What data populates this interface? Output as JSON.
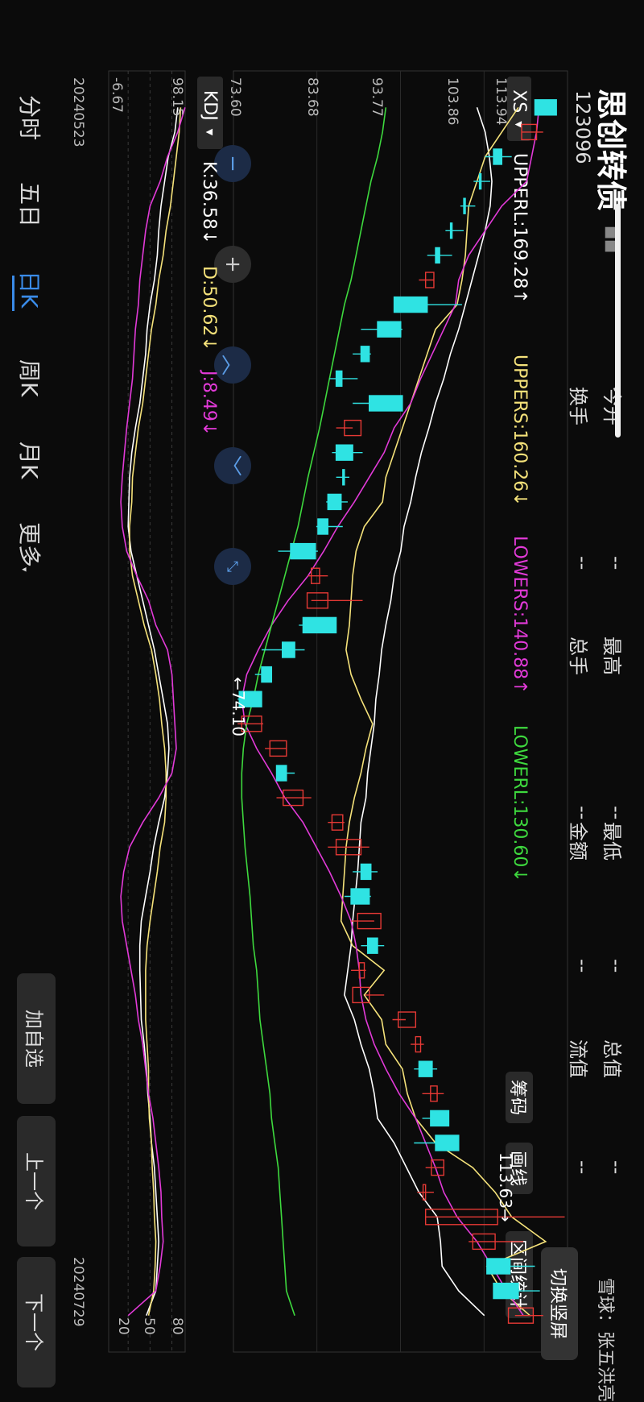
{
  "header": {
    "title": "思创转债",
    "code": "123096",
    "title_badge": "■■",
    "orientation_button": "切换竖屏"
  },
  "quote": [
    {
      "label": "今开",
      "value": "--"
    },
    {
      "label": "最高",
      "value": "--"
    },
    {
      "label": "最低",
      "value": "--"
    },
    {
      "label": "总值",
      "value": "--"
    },
    {
      "label": "换手",
      "value": "--"
    },
    {
      "label": "总手",
      "value": "--"
    },
    {
      "label": "金额",
      "value": "--"
    },
    {
      "label": "流值",
      "value": "--"
    }
  ],
  "main_indicator": {
    "selector": "XS",
    "items": [
      {
        "label": "UPPERL:169.28↑",
        "color": "#ffffff"
      },
      {
        "label": "UPPERS:160.26↓",
        "color": "#f5e27a"
      },
      {
        "label": "LOWERS:140.88↑",
        "color": "#e23ad8"
      },
      {
        "label": "LOWERL:130.60↓",
        "color": "#3ed93e"
      }
    ]
  },
  "tools": {
    "chips": "筹码",
    "draw": "画线",
    "range": "区间统计"
  },
  "sub_indicator": {
    "selector": "KDJ",
    "items": [
      {
        "label": "K:36.58↓",
        "color": "#ffffff"
      },
      {
        "label": "D:50.62↓",
        "color": "#f5e27a"
      },
      {
        "label": "J:8.49↓",
        "color": "#e23ad8"
      }
    ]
  },
  "price_axis": [
    "113.94",
    "103.86",
    "93.77",
    "83.68",
    "73.60"
  ],
  "kdj_axis": [
    "98.15",
    "80",
    "50",
    "20",
    "-6.67"
  ],
  "annotations": {
    "high": "113.63→",
    "low": "←74.10"
  },
  "dates": {
    "start": "20240523",
    "end": "20240729"
  },
  "tabs": [
    {
      "label": "分时",
      "active": false
    },
    {
      "label": "五日",
      "active": false
    },
    {
      "label": "日K",
      "active": true
    },
    {
      "label": "周K",
      "active": false
    },
    {
      "label": "月K",
      "active": false
    },
    {
      "label": "更多",
      "active": false
    }
  ],
  "side_buttons": [
    "加自选",
    "上一个",
    "下一个"
  ],
  "watermark": "雪球：张五洪亮",
  "colors": {
    "up": "#e53935",
    "down": "#2fe3e3",
    "accent": "#3a8be8"
  },
  "chart_data": {
    "type": "candlestick",
    "ylim": [
      73.6,
      113.94
    ],
    "candles": [
      {
        "o": 110.0,
        "h": 112.6,
        "l": 110.0,
        "c": 112.6,
        "up": false
      },
      {
        "o": 110.2,
        "h": 111.0,
        "l": 108.4,
        "c": 108.4,
        "up": true
      },
      {
        "o": 105.0,
        "h": 107.2,
        "l": 104.0,
        "c": 106.0,
        "up": false
      },
      {
        "o": 103.5,
        "h": 104.6,
        "l": 102.6,
        "c": 103.5,
        "up": false
      },
      {
        "o": 101.6,
        "h": 102.8,
        "l": 101.0,
        "c": 101.6,
        "up": false
      },
      {
        "o": 100.0,
        "h": 101.4,
        "l": 99.2,
        "c": 100.0,
        "up": false
      },
      {
        "o": 98.5,
        "h": 100.0,
        "l": 97.0,
        "c": 98.0,
        "up": false
      },
      {
        "o": 96.8,
        "h": 97.8,
        "l": 96.0,
        "c": 97.8,
        "up": true
      },
      {
        "o": 97.0,
        "h": 101.2,
        "l": 94.8,
        "c": 93.0,
        "up": false
      },
      {
        "o": 91.0,
        "h": 94.0,
        "l": 89.0,
        "c": 93.8,
        "up": false
      },
      {
        "o": 89.0,
        "h": 90.2,
        "l": 88.0,
        "c": 90.0,
        "up": false
      },
      {
        "o": 86.7,
        "h": 88.6,
        "l": 85.2,
        "c": 86.0,
        "up": false
      },
      {
        "o": 90.0,
        "h": 94.0,
        "l": 88.0,
        "c": 94.0,
        "up": false
      },
      {
        "o": 87.0,
        "h": 88.0,
        "l": 86.0,
        "c": 89.0,
        "up": true
      },
      {
        "o": 88.0,
        "h": 89.2,
        "l": 85.5,
        "c": 86.0,
        "up": false
      },
      {
        "o": 87.0,
        "h": 87.6,
        "l": 86.0,
        "c": 86.8,
        "up": false
      },
      {
        "o": 86.6,
        "h": 87.4,
        "l": 84.8,
        "c": 85.0,
        "up": false
      },
      {
        "o": 85.0,
        "h": 86.8,
        "l": 83.6,
        "c": 83.8,
        "up": false
      },
      {
        "o": 80.5,
        "h": 83.8,
        "l": 79.0,
        "c": 83.5,
        "up": false
      },
      {
        "o": 84.0,
        "h": 85.0,
        "l": 82.6,
        "c": 83.0,
        "up": true
      },
      {
        "o": 85.0,
        "h": 89.2,
        "l": 83.0,
        "c": 82.5,
        "up": true
      },
      {
        "o": 82.0,
        "h": 86.0,
        "l": 81.5,
        "c": 86.0,
        "up": false
      },
      {
        "o": 79.5,
        "h": 82.2,
        "l": 77.0,
        "c": 81.0,
        "up": false
      },
      {
        "o": 77.0,
        "h": 78.2,
        "l": 76.2,
        "c": 78.2,
        "up": false
      },
      {
        "o": 74.3,
        "h": 77.0,
        "l": 74.1,
        "c": 77.0,
        "up": false
      },
      {
        "o": 74.6,
        "h": 77.2,
        "l": 74.1,
        "c": 77.0,
        "up": true
      },
      {
        "o": 78.0,
        "h": 80.0,
        "l": 77.4,
        "c": 80.0,
        "up": true
      },
      {
        "o": 80.0,
        "h": 81.0,
        "l": 79.0,
        "c": 78.8,
        "up": false
      },
      {
        "o": 79.6,
        "h": 83.0,
        "l": 78.8,
        "c": 82.0,
        "up": true
      },
      {
        "o": 85.5,
        "h": 87.0,
        "l": 85.0,
        "c": 86.8,
        "up": true
      },
      {
        "o": 86.0,
        "h": 90.0,
        "l": 85.0,
        "c": 89.0,
        "up": true
      },
      {
        "o": 89.0,
        "h": 91.0,
        "l": 88.0,
        "c": 90.2,
        "up": false
      },
      {
        "o": 87.8,
        "h": 90.2,
        "l": 87.0,
        "c": 90.0,
        "up": false
      },
      {
        "o": 88.6,
        "h": 90.6,
        "l": 87.8,
        "c": 91.4,
        "up": true
      },
      {
        "o": 89.8,
        "h": 91.8,
        "l": 89.0,
        "c": 91.0,
        "up": false
      },
      {
        "o": 88.8,
        "h": 89.6,
        "l": 87.8,
        "c": 89.4,
        "up": true
      },
      {
        "o": 90.0,
        "h": 91.8,
        "l": 89.5,
        "c": 88.0,
        "up": true
      },
      {
        "o": 93.5,
        "h": 94.4,
        "l": 92.8,
        "c": 95.6,
        "up": true
      },
      {
        "o": 95.6,
        "h": 96.6,
        "l": 95.0,
        "c": 96.2,
        "up": true
      },
      {
        "o": 96.0,
        "h": 98.2,
        "l": 95.4,
        "c": 97.6,
        "up": false
      },
      {
        "o": 97.4,
        "h": 99.0,
        "l": 96.4,
        "c": 98.2,
        "up": true
      },
      {
        "o": 97.4,
        "h": 99.0,
        "l": 96.4,
        "c": 99.6,
        "up": false
      },
      {
        "o": 98.0,
        "h": 99.0,
        "l": 95.4,
        "c": 100.8,
        "up": false
      },
      {
        "o": 97.5,
        "h": 99.0,
        "l": 96.8,
        "c": 99.0,
        "up": true
      },
      {
        "o": 96.5,
        "h": 97.8,
        "l": 95.8,
        "c": 96.8,
        "up": true
      },
      {
        "o": 96.8,
        "h": 113.6,
        "l": 96.8,
        "c": 105.5,
        "up": true
      },
      {
        "o": 102.5,
        "h": 108.6,
        "l": 102.0,
        "c": 105.2,
        "up": true
      },
      {
        "o": 107.0,
        "h": 110.0,
        "l": 104.5,
        "c": 104.2,
        "up": false
      },
      {
        "o": 108.0,
        "h": 110.6,
        "l": 106.6,
        "c": 105.0,
        "up": false
      },
      {
        "o": 109.8,
        "h": 111.0,
        "l": 107.6,
        "c": 106.8,
        "up": true
      }
    ],
    "lines": {
      "UPPERL": [
        103.0,
        104.0,
        104.5,
        104.8,
        104.6,
        104.0,
        103.2,
        102.4,
        101.6,
        100.8,
        99.8,
        99.0,
        98.0,
        97.2,
        96.3,
        95.6,
        95.0,
        94.2,
        93.8,
        93.0,
        92.6,
        92.0,
        91.5,
        91.2,
        90.8,
        90.6,
        90.2,
        89.8,
        89.6,
        89.0,
        88.8,
        88.6,
        88.3,
        88.0,
        87.8,
        87.4,
        87.0,
        88.2,
        89.0,
        90.0,
        90.6,
        91.0,
        93.0,
        94.5,
        96.0,
        98.2,
        98.6,
        98.8,
        100.8,
        103.9
      ],
      "UPPERS": [
        108.0,
        106.0,
        104.0,
        103.0,
        102.0,
        101.8,
        101.6,
        101.2,
        100.6,
        98.0,
        97.0,
        96.0,
        95.0,
        94.0,
        93.0,
        92.0,
        91.6,
        89.4,
        88.4,
        88.0,
        87.8,
        87.6,
        87.2,
        87.8,
        89.0,
        90.4,
        89.6,
        89.0,
        88.2,
        87.6,
        87.2,
        87.0,
        86.8,
        86.6,
        88.0,
        91.8,
        89.4,
        91.5,
        92.0,
        94.0,
        94.6,
        95.6,
        98.0,
        102.5,
        105.2,
        107.2,
        111.3,
        104.2,
        106.0,
        109.4
      ],
      "LOWERS": [
        110.5,
        110.2,
        109.6,
        109.0,
        106.0,
        104.0,
        102.0,
        100.8,
        100.4,
        99.0,
        97.6,
        96.2,
        95.0,
        93.0,
        91.8,
        90.0,
        88.2,
        86.2,
        84.5,
        82.6,
        80.2,
        78.2,
        76.6,
        75.2,
        74.6,
        75.0,
        76.4,
        78.2,
        79.8,
        82.0,
        83.6,
        85.2,
        86.6,
        87.8,
        88.4,
        88.8,
        89.0,
        89.6,
        90.6,
        92.0,
        93.6,
        95.6,
        96.8,
        98.0,
        99.0,
        100.6,
        103.0,
        104.8,
        106.6,
        108.6
      ],
      "LOWERL": [
        92.0,
        91.6,
        91.0,
        90.2,
        89.6,
        89.0,
        88.4,
        87.8,
        87.0,
        86.4,
        85.8,
        85.2,
        84.6,
        84.0,
        83.3,
        82.6,
        82.0,
        81.4,
        80.6,
        79.8,
        79.0,
        78.2,
        77.4,
        76.6,
        76.0,
        75.2,
        74.8,
        74.6,
        74.6,
        74.8,
        75.0,
        75.3,
        75.6,
        75.8,
        76.0,
        76.4,
        76.6,
        76.8,
        77.2,
        77.6,
        78.0,
        78.2,
        78.6,
        79.0,
        79.2,
        79.4,
        79.6,
        79.8,
        80.0,
        81.0
      ]
    },
    "kdj_ylim": [
      -6.67,
      98.15
    ],
    "kdj_lines": {
      "K": [
        88,
        84,
        75,
        70,
        65,
        62,
        60,
        56,
        50,
        46,
        44,
        40,
        36,
        30,
        25,
        22,
        21,
        20,
        24,
        32,
        40,
        48,
        56,
        62,
        68,
        74,
        76,
        74,
        70,
        62,
        55,
        50,
        44,
        38,
        36,
        36,
        37,
        38,
        42,
        45,
        47,
        50,
        52,
        56,
        58,
        60,
        62,
        60,
        58,
        45
      ],
      "D": [
        92,
        90,
        86,
        82,
        78,
        72,
        68,
        62,
        58,
        52,
        48,
        44,
        40,
        34,
        30,
        26,
        25,
        22,
        22,
        26,
        34,
        42,
        52,
        58,
        63,
        66,
        70,
        72,
        72,
        70,
        64,
        60,
        55,
        50,
        46,
        44,
        44,
        44,
        46,
        48,
        48,
        49,
        52,
        53,
        55,
        56,
        58,
        57,
        55,
        48
      ],
      "J": [
        98,
        88,
        74,
        64,
        50,
        44,
        40,
        36,
        34,
        30,
        28,
        26,
        22,
        18,
        15,
        12,
        10,
        12,
        18,
        32,
        48,
        58,
        74,
        80,
        82,
        84,
        86,
        80,
        62,
        40,
        22,
        14,
        10,
        12,
        18,
        24,
        30,
        34,
        40,
        44,
        48,
        54,
        58,
        62,
        65,
        66,
        68,
        64,
        58,
        20
      ]
    }
  }
}
